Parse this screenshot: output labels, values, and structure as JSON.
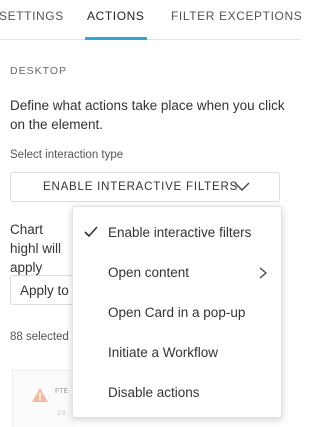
{
  "tabs": [
    {
      "label": "SETTINGS"
    },
    {
      "label": "ACTIONS"
    },
    {
      "label": "FILTER EXCEPTIONS"
    }
  ],
  "active_tab": "ACTIONS",
  "accent_color": "#31a6d4",
  "section_label": "DESKTOP",
  "description": "Define what actions take place when you click on the element.",
  "interaction_label": "Select interaction type",
  "interaction_select": {
    "value": "ENABLE INTERACTIVE FILTERS",
    "icon": "chevron-down-icon"
  },
  "chart_highlight_text": "Chart highl will apply",
  "apply_button_label": "Apply to",
  "selected_count_text": "88 selected",
  "card_preview": {
    "title": "FTE",
    "subtitle": "2.0",
    "icon": "warning-icon"
  },
  "dropdown": {
    "items": [
      {
        "label": "Enable interactive filters",
        "checked": true,
        "has_submenu": false
      },
      {
        "label": "Open content",
        "checked": false,
        "has_submenu": true
      },
      {
        "label": "Open Card in a pop-up",
        "checked": false,
        "has_submenu": false
      },
      {
        "label": "Initiate a Workflow",
        "checked": false,
        "has_submenu": false
      },
      {
        "label": "Disable actions",
        "checked": false,
        "has_submenu": false
      }
    ]
  }
}
